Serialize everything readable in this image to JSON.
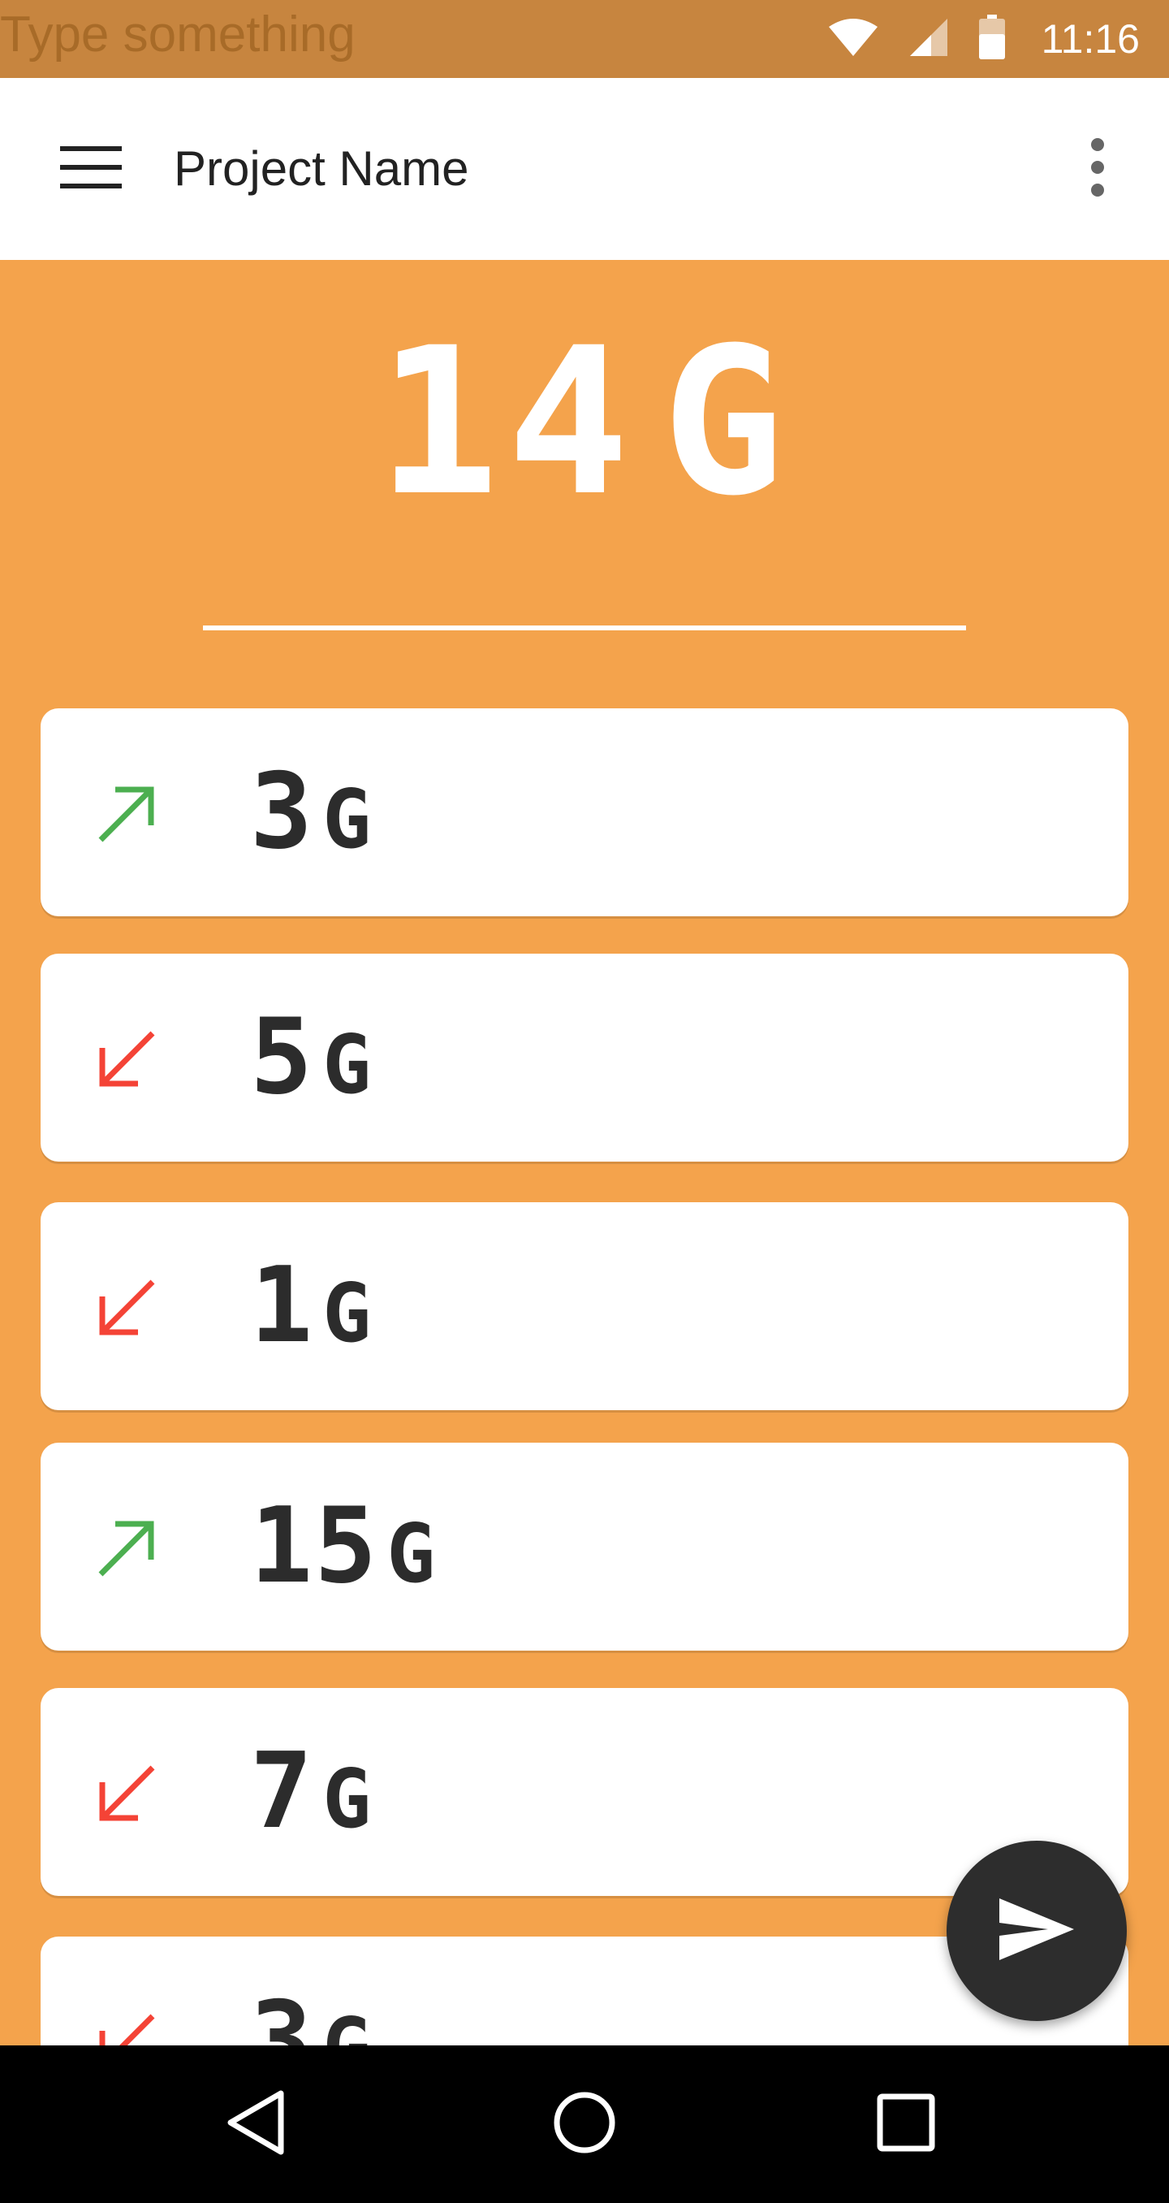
{
  "status_bar": {
    "placeholder": "Type something",
    "time": "11:16",
    "icons": [
      "wifi-icon",
      "signal-icon",
      "battery-icon"
    ]
  },
  "app_bar": {
    "title": "Project Name",
    "menu_icon": "hamburger-menu-icon",
    "overflow_icon": "more-vert-icon"
  },
  "total": {
    "value": "14",
    "unit": "G"
  },
  "items": [
    {
      "value": "3",
      "unit": "G",
      "trend": "up"
    },
    {
      "value": "5",
      "unit": "G",
      "trend": "down"
    },
    {
      "value": "1",
      "unit": "G",
      "trend": "down"
    },
    {
      "value": "15",
      "unit": "G",
      "trend": "up"
    },
    {
      "value": "7",
      "unit": "G",
      "trend": "down"
    },
    {
      "value": "3",
      "unit": "G",
      "trend": "down"
    }
  ],
  "fab": {
    "icon": "send-icon"
  },
  "nav_bar": {
    "icons": [
      "back-icon",
      "home-icon",
      "recents-icon"
    ]
  },
  "colors": {
    "background": "#F4A34C",
    "status_bar": "#C7853F",
    "up": "#4CAF50",
    "down": "#F44336",
    "text_dark": "#2c2c2c",
    "fab": "#2d2d2d"
  }
}
